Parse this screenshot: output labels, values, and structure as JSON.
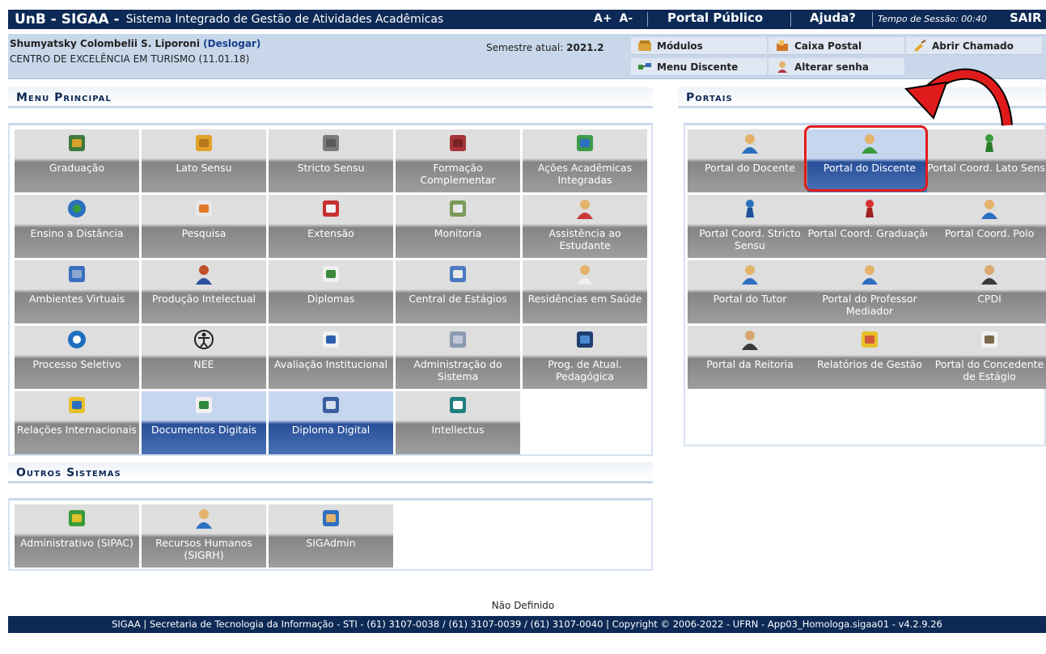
{
  "header": {
    "brand": "UnB - SIGAA -",
    "system_name": "Sistema Integrado de Gestão de Atividades Acadêmicas",
    "font_increase": "A+",
    "font_decrease": "A-",
    "portal_publico": "Portal Público",
    "ajuda": "Ajuda?",
    "session_label": "Tempo de Sessão: 00:40",
    "sair": "SAIR"
  },
  "user": {
    "name": "Shumyatsky Colombelii S. Liporoni",
    "logout": "(Deslogar)",
    "unit": "CENTRO DE EXCELÊNCIA EM TURISMO (11.01.18)",
    "semester_label": "Semestre atual:",
    "semester_value": "2021.2"
  },
  "quick_links": {
    "modulos": "Módulos",
    "caixa_postal": "Caixa Postal",
    "abrir_chamado": "Abrir Chamado",
    "menu_discente": "Menu Discente",
    "alterar_senha": "Alterar senha"
  },
  "sections": {
    "menu_principal": "Menu Principal",
    "portais": "Portais",
    "outros_sistemas": "Outros Sistemas"
  },
  "menu_principal": [
    {
      "label": "Graduação",
      "icon": "books-icon"
    },
    {
      "label": "Lato Sensu",
      "icon": "folder-icon"
    },
    {
      "label": "Stricto Sensu",
      "icon": "briefcase-icon"
    },
    {
      "label": "Formação Complementar",
      "icon": "book-icon"
    },
    {
      "label": "Ações Acadêmicas Integradas",
      "icon": "puzzle-icon"
    },
    {
      "label": "Ensino a Distância",
      "icon": "globe-icon"
    },
    {
      "label": "Pesquisa",
      "icon": "flask-icon"
    },
    {
      "label": "Extensão",
      "icon": "house-icon"
    },
    {
      "label": "Monitoria",
      "icon": "board-icon"
    },
    {
      "label": "Assistência ao Estudante",
      "icon": "support-icon"
    },
    {
      "label": "Ambientes Virtuais",
      "icon": "users-icon"
    },
    {
      "label": "Produção Intelectual",
      "icon": "user-check-icon"
    },
    {
      "label": "Diplomas",
      "icon": "certificate-icon"
    },
    {
      "label": "Central de Estágios",
      "icon": "contact-card-icon"
    },
    {
      "label": "Residências em Saúde",
      "icon": "doctor-icon"
    },
    {
      "label": "Processo Seletivo",
      "icon": "spiral-icon"
    },
    {
      "label": "NEE",
      "icon": "accessibility-icon"
    },
    {
      "label": "Avaliação Institucional",
      "icon": "document-edit-icon"
    },
    {
      "label": "Administração do Sistema",
      "icon": "gears-icon"
    },
    {
      "label": "Prog. de Atual. Pedagógica",
      "icon": "presentation-icon"
    },
    {
      "label": "Relações Internacionais",
      "icon": "international-icon"
    },
    {
      "label": "Documentos Digitais",
      "icon": "digital-doc-icon"
    },
    {
      "label": "Diploma Digital",
      "icon": "diploma-icon"
    },
    {
      "label": "Intellectus",
      "icon": "intellectus-icon"
    }
  ],
  "portais": [
    {
      "label": "Portal do Docente",
      "icon": "person-blue-icon"
    },
    {
      "label": "Portal do Discente",
      "icon": "person-green-icon"
    },
    {
      "label": "Portal Coord. Lato Sensu",
      "icon": "pawn-green-icon"
    },
    {
      "label": "Portal Coord. Stricto Sensu",
      "icon": "pawn-blue-icon"
    },
    {
      "label": "Portal Coord. Graduação",
      "icon": "pawn-red-icon"
    },
    {
      "label": "Portal Coord. Polo",
      "icon": "person-blue-icon"
    },
    {
      "label": "Portal do Tutor",
      "icon": "person-blue-icon"
    },
    {
      "label": "Portal do Professor Mediador",
      "icon": "person-blue-icon"
    },
    {
      "label": "CPDI",
      "icon": "person-dark-icon"
    },
    {
      "label": "Portal da Reitoria",
      "icon": "person-dark-icon"
    },
    {
      "label": "Relatórios de Gestão",
      "icon": "reports-icon"
    },
    {
      "label": "Portal do Concedente de Estágio",
      "icon": "id-card-icon"
    }
  ],
  "outros_sistemas": [
    {
      "label": "Administrativo (SIPAC)",
      "icon": "money-icon"
    },
    {
      "label": "Recursos Humanos (SIGRH)",
      "icon": "person-blue-icon"
    },
    {
      "label": "SIGAdmin",
      "icon": "admin-computer-icon"
    }
  ],
  "footer": {
    "note": "Não Definido",
    "text": "SIGAA | Secretaria de Tecnologia da Informação - STI - (61) 3107-0038 / (61) 3107-0039 / (61) 3107-0040 | Copyright © 2006-2022 - UFRN - App03_Homologa.sigaa01 - v4.2.9.26"
  },
  "colors": {
    "navy": "#0d2a56",
    "light_blue": "#c8d7ea",
    "highlight": "#e01b1b"
  }
}
